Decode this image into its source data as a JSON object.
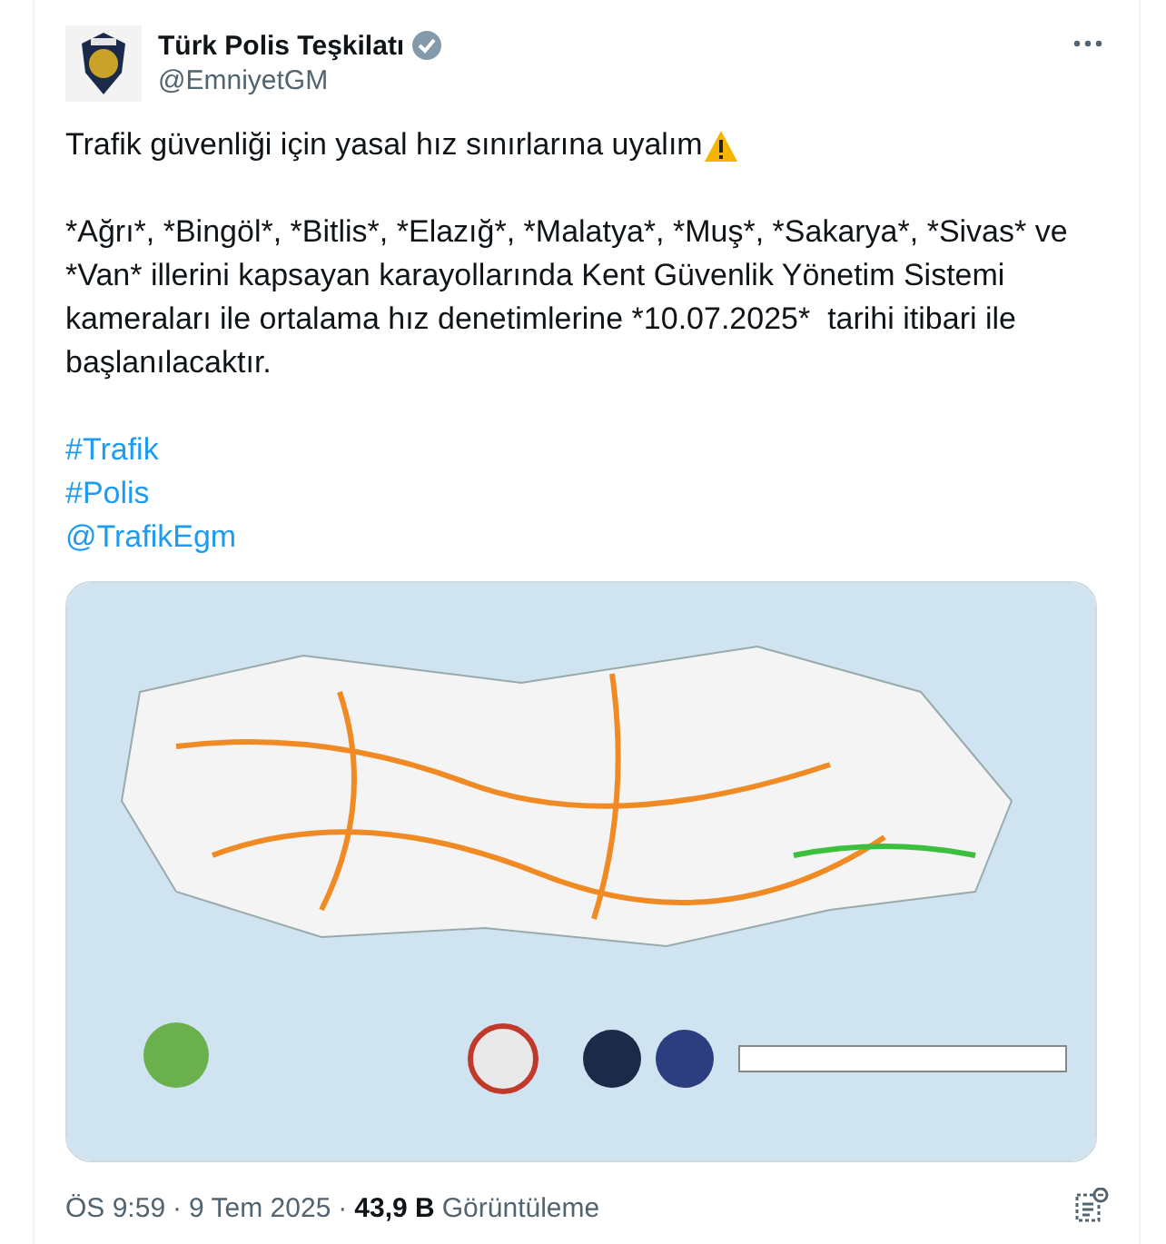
{
  "author": {
    "name": "Türk Polis Teşkilatı",
    "handle": "@EmniyetGM",
    "verified": true
  },
  "text": {
    "first_line": "Trafik güvenliği için yasal hız sınırlarına uyalım",
    "body": "*Ağrı*, *Bingöl*, *Bitlis*, *Elazığ*, *Malatya*, *Muş*, *Sakarya*, *Sivas* ve *Van* illerini kapsayan karayollarında Kent Güvenlik Yönetim Sistemi kameraları ile ortalama hız denetimlerine *10.07.2025*  tarihi itibari ile başlanılacaktır."
  },
  "links": [
    "#Trafik",
    "#Polis",
    "@TrafikEgm"
  ],
  "footer": {
    "time": "ÖS 9:59",
    "separator": "·",
    "date": "9 Tem 2025",
    "views": "43,9 B",
    "views_label": "Görüntüleme"
  }
}
